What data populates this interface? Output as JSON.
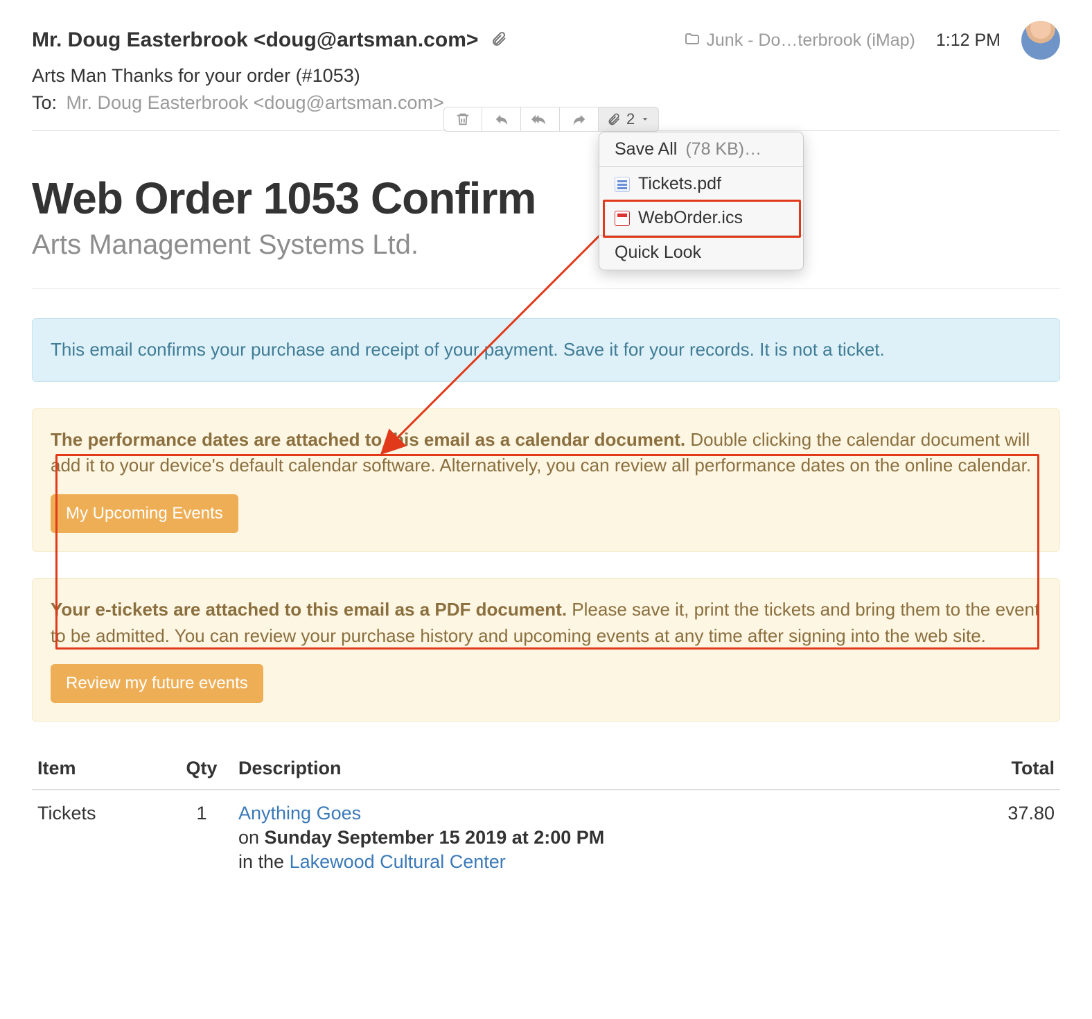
{
  "header": {
    "from": "Mr. Doug Easterbrook <doug@artsman.com>",
    "mailbox": "Junk - Do…terbrook (iMap)",
    "time": "1:12 PM",
    "subject": "Arts Man Thanks for your order (#1053)",
    "to_label": "To:",
    "to_addr": "Mr. Doug Easterbrook <doug@artsman.com>"
  },
  "toolbar": {
    "attachment_count": "2"
  },
  "menu": {
    "save_all_label": "Save All",
    "save_all_size": "(78 KB)…",
    "file1": "Tickets.pdf",
    "file2": "WebOrder.ics",
    "quick_look": "Quick Look"
  },
  "email": {
    "title": "Web Order 1053 Confirm",
    "org": "Arts Management Systems Ltd.",
    "confirm_text": "This email confirms your purchase and receipt of your payment. Save it for your records. It is not a ticket.",
    "cal_bold": "The performance dates are attached to this email as a calendar document.",
    "cal_rest": " Double clicking the calendar document will add it to your device's default calendar software. Alternatively, you can review all performance dates on the online calendar.",
    "cal_button": "My Upcoming Events",
    "tix_bold": "Your e-tickets are attached to this email as a PDF document.",
    "tix_rest": " Please save it, print the tickets and bring them to the event to be admitted. You can review your purchase history and upcoming events at any time after signing into the web site.",
    "tix_button": "Review my future events"
  },
  "table": {
    "headers": {
      "item": "Item",
      "qty": "Qty",
      "desc": "Description",
      "total": "Total"
    },
    "row": {
      "item": "Tickets",
      "qty": "1",
      "title": "Anything Goes",
      "on": "on ",
      "date": "Sunday September 15 2019 at 2:00 PM",
      "in": "in the ",
      "venue": "Lakewood Cultural Center",
      "total": "37.80"
    }
  }
}
